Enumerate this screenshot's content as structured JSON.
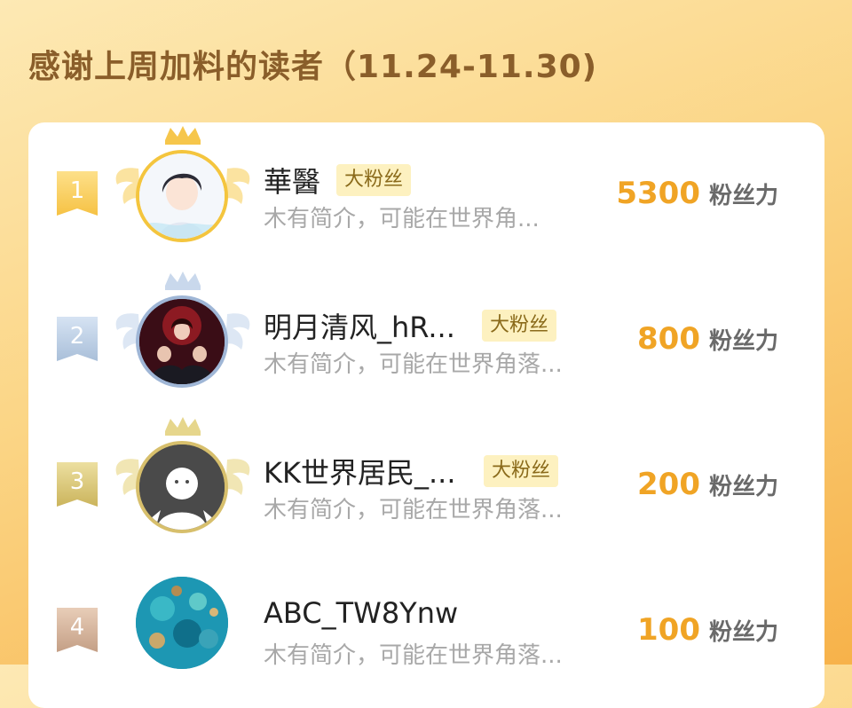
{
  "header": {
    "title": "感谢上周加料的读者（11.24-11.30)"
  },
  "readers": [
    {
      "rank": "1",
      "name": "華醫",
      "badge": "大粉丝",
      "intro": "木有简介，可能在世界角...",
      "power": "5300",
      "unit": "粉丝力",
      "avatar_icon": "anime-boy-avatar"
    },
    {
      "rank": "2",
      "name": "明月清风_hR...",
      "badge": "大粉丝",
      "intro": "木有简介，可能在世界角落...",
      "power": "800",
      "unit": "粉丝力",
      "avatar_icon": "dark-group-art-avatar"
    },
    {
      "rank": "3",
      "name": "KK世界居民_...",
      "badge": "大粉丝",
      "intro": "木有简介，可能在世界角落...",
      "power": "200",
      "unit": "粉丝力",
      "avatar_icon": "default-person-avatar"
    },
    {
      "rank": "4",
      "name": "ABC_TW8Ynw",
      "badge": "",
      "intro": "木有简介，可能在世界角落...",
      "power": "100",
      "unit": "粉丝力",
      "avatar_icon": "ocean-coral-avatar"
    }
  ],
  "colors": {
    "gold": "#f4c53e",
    "silver": "#9fb6d6",
    "bronze": "#d7bf6c",
    "power_number": "#f0a425",
    "badge_bg": "#fdf1c0"
  }
}
